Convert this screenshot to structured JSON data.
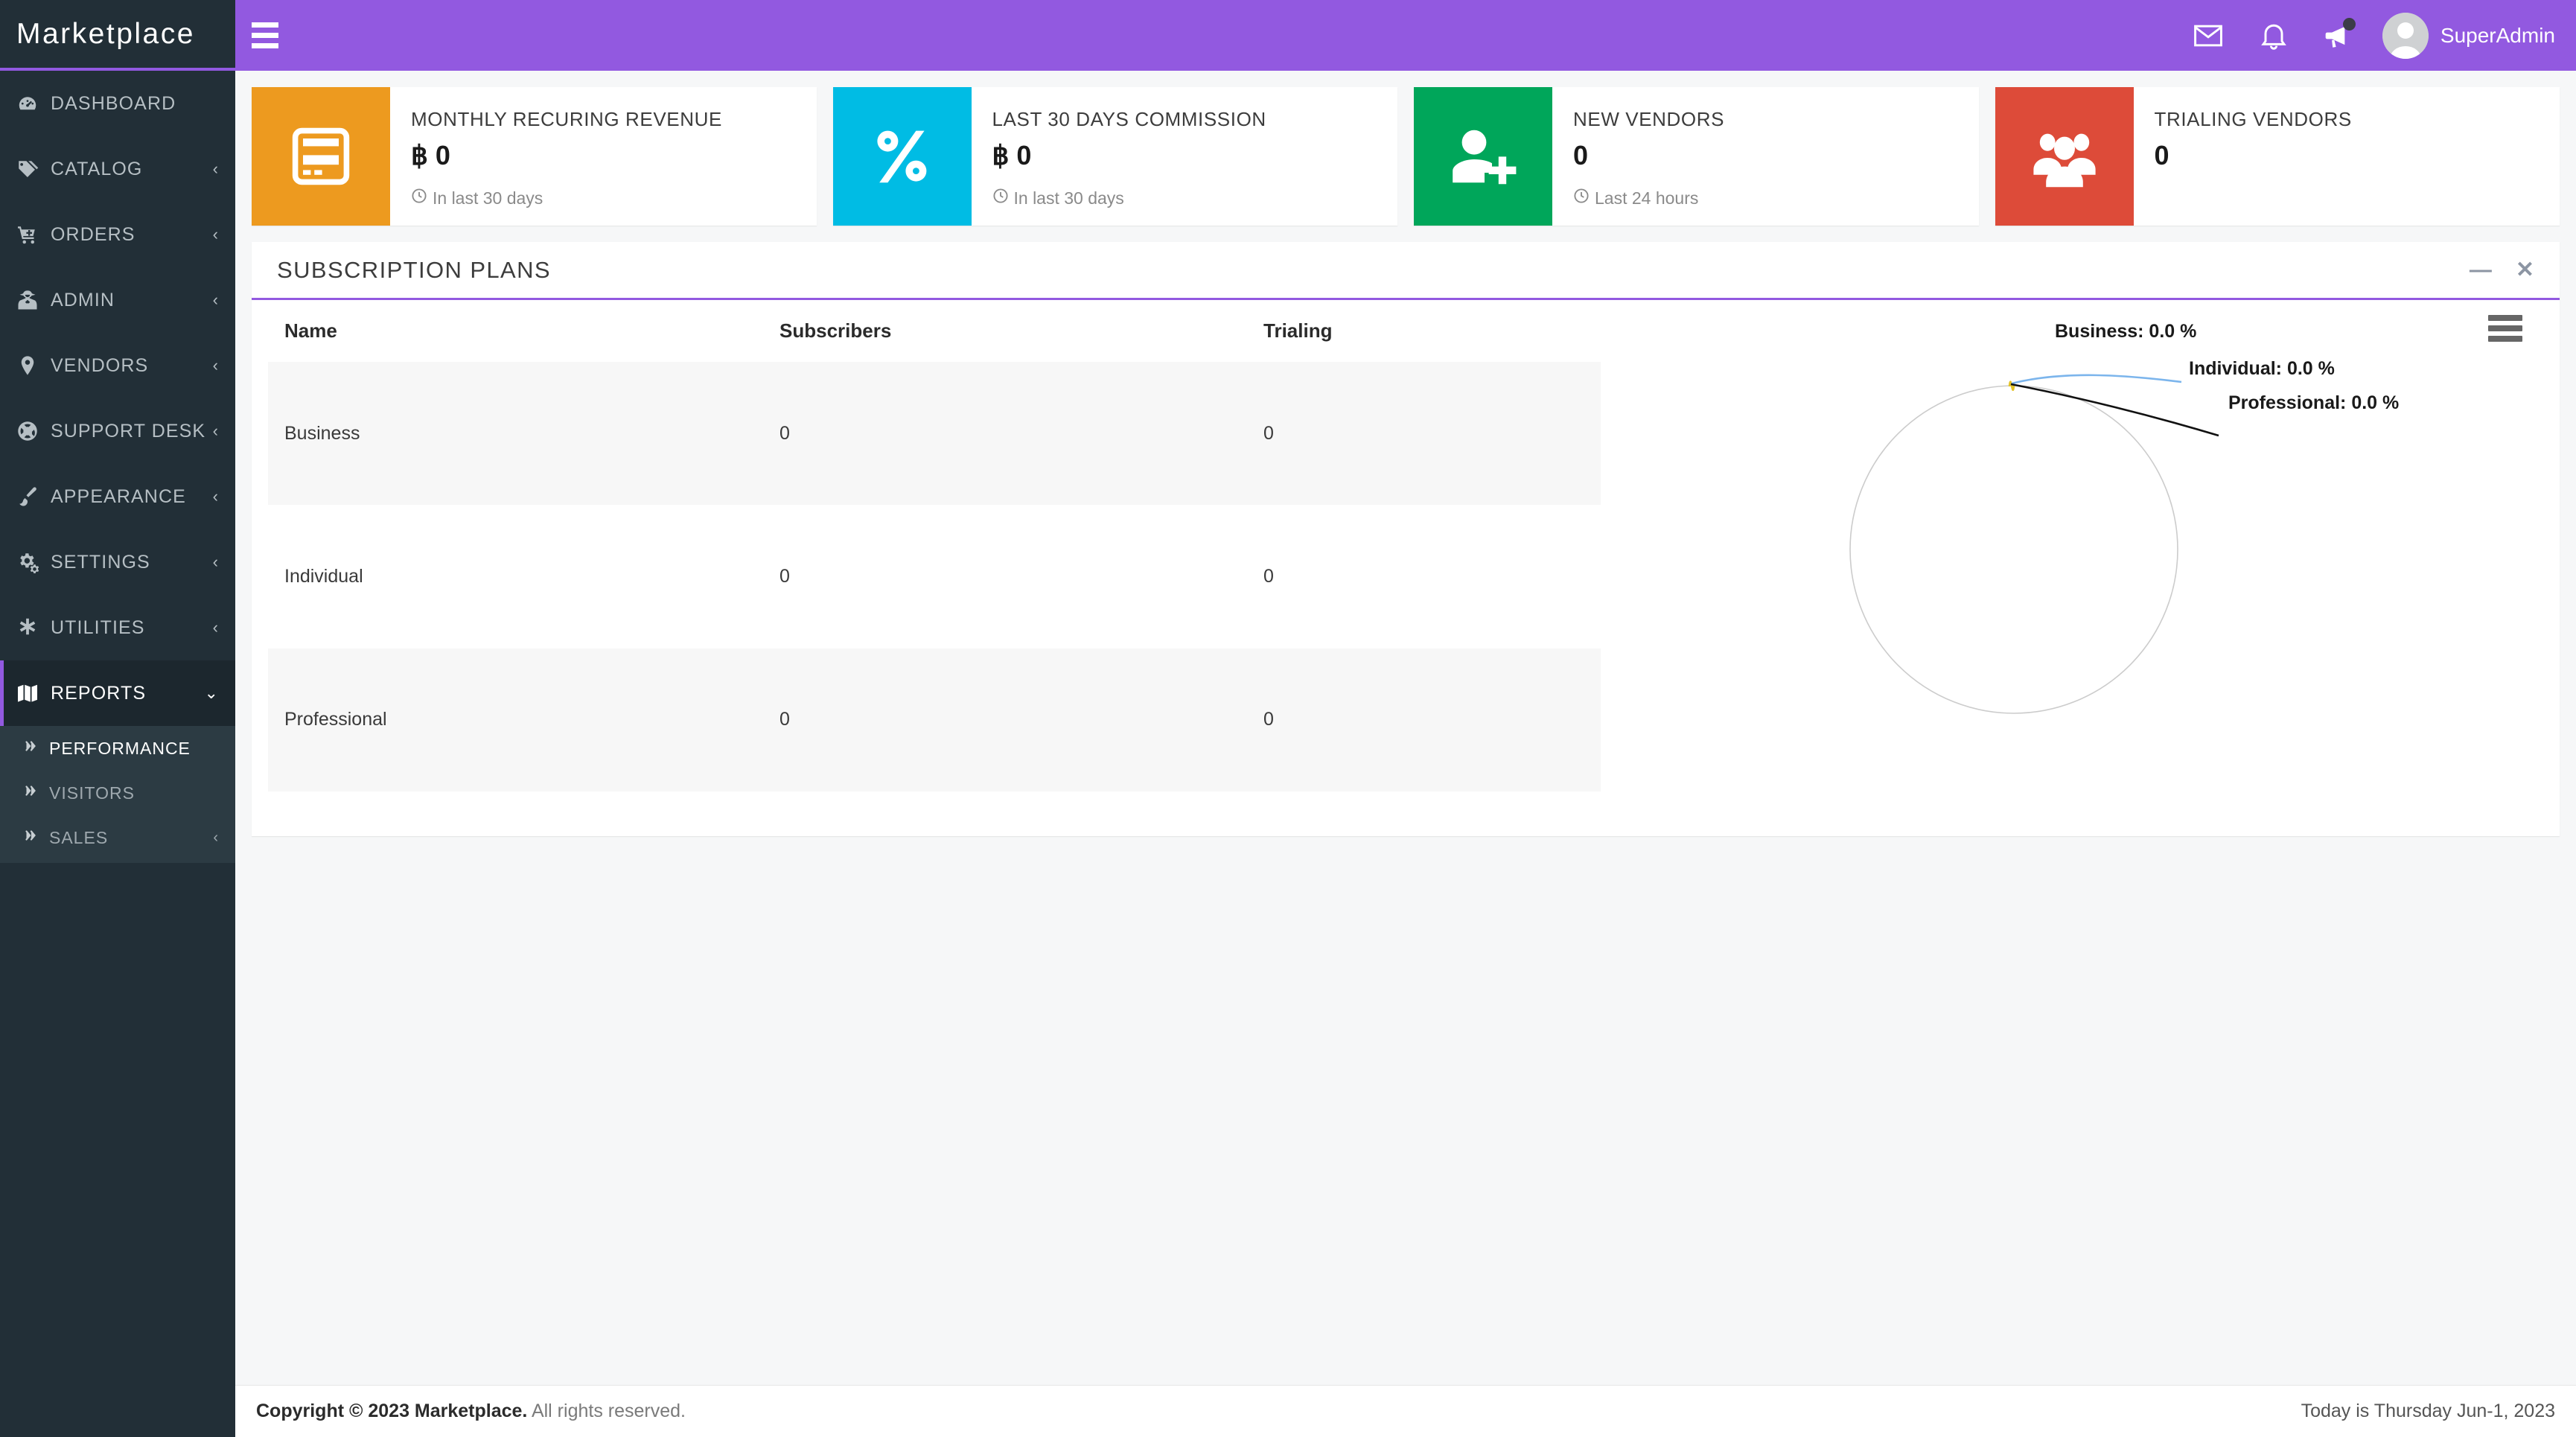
{
  "brand": {
    "logo_text": "Marketplace",
    "accent_color": "#9259e0",
    "sidebar_color": "#222f37"
  },
  "topbar": {
    "menu_toggle": "hamburger-icon",
    "mail_icon": "envelope-icon",
    "bell_icon": "bell-icon",
    "bullhorn_icon": "bullhorn-icon",
    "user_name": "SuperAdmin"
  },
  "sidebar": {
    "items": [
      {
        "label": "DASHBOARD",
        "icon": "tachometer-icon",
        "chevron": "",
        "active": false
      },
      {
        "label": "CATALOG",
        "icon": "tags-icon",
        "chevron": "‹",
        "active": false
      },
      {
        "label": "ORDERS",
        "icon": "cart-icon",
        "chevron": "‹",
        "active": false
      },
      {
        "label": "ADMIN",
        "icon": "user-secret-icon",
        "chevron": "‹",
        "active": false
      },
      {
        "label": "VENDORS",
        "icon": "map-marker-icon",
        "chevron": "‹",
        "active": false
      },
      {
        "label": "SUPPORT DESK",
        "icon": "life-ring-icon",
        "chevron": "‹",
        "active": false
      },
      {
        "label": "APPEARANCE",
        "icon": "paint-brush-icon",
        "chevron": "‹",
        "active": false
      },
      {
        "label": "SETTINGS",
        "icon": "cogs-icon",
        "chevron": "‹",
        "active": false
      },
      {
        "label": "UTILITIES",
        "icon": "asterisk-icon",
        "chevron": "‹",
        "active": false
      },
      {
        "label": "REPORTS",
        "icon": "map-icon",
        "chevron": "⌄",
        "active": true
      }
    ],
    "submenu": [
      {
        "label": "PERFORMANCE",
        "icon": "angle-double-right-icon",
        "chevron": "",
        "active": true
      },
      {
        "label": "VISITORS",
        "icon": "angle-double-right-icon",
        "chevron": "",
        "active": false
      },
      {
        "label": "SALES",
        "icon": "angle-double-right-icon",
        "chevron": "‹",
        "active": false
      }
    ]
  },
  "cards": [
    {
      "title": "MONTHLY RECURING REVENUE",
      "value": "฿ 0",
      "footer": "In last 30 days",
      "footer_icon": "clock-icon",
      "icon": "credit-card-icon",
      "color": "#ed9a1f"
    },
    {
      "title": "LAST 30 DAYS COMMISSION",
      "value": "฿ 0",
      "footer": "In last 30 days",
      "footer_icon": "clock-icon",
      "icon": "percent-icon",
      "color": "#00bce4"
    },
    {
      "title": "NEW VENDORS",
      "value": "0",
      "footer": "Last 24 hours",
      "footer_icon": "clock-icon",
      "icon": "user-plus-icon",
      "color": "#00a65a"
    },
    {
      "title": "TRIALING VENDORS",
      "value": "0",
      "footer": "",
      "footer_icon": "",
      "icon": "users-icon",
      "color": "#dd4b39"
    }
  ],
  "panel": {
    "title": "SUBSCRIPTION PLANS",
    "minimize_label": "—",
    "close_label": "✕",
    "table": {
      "headers": [
        "Name",
        "Subscribers",
        "Trialing"
      ],
      "rows": [
        [
          "Business",
          "0",
          "0"
        ],
        [
          "Individual",
          "0",
          "0"
        ],
        [
          "Professional",
          "0",
          "0"
        ]
      ]
    },
    "export_menu": "hamburger-export-icon"
  },
  "chart_data": {
    "type": "pie",
    "title": "",
    "categories": [
      "Business",
      "Individual",
      "Professional"
    ],
    "values": [
      0.0,
      0.0,
      0.0
    ],
    "labels": [
      "Business: 0.0 %",
      "Individual: 0.0 %",
      "Professional: 0.0 %"
    ],
    "colors": [
      "#e3c326",
      "#7cb5ec",
      "#111111"
    ],
    "unit": "%",
    "legend": "none",
    "datalabels": true,
    "empty": true,
    "empty_ring_color": "#cccccc"
  },
  "footer": {
    "copyright_bold": "Copyright © 2023 Marketplace.",
    "copyright_rest": " All rights reserved.",
    "today": "Today is Thursday Jun-1, 2023"
  }
}
